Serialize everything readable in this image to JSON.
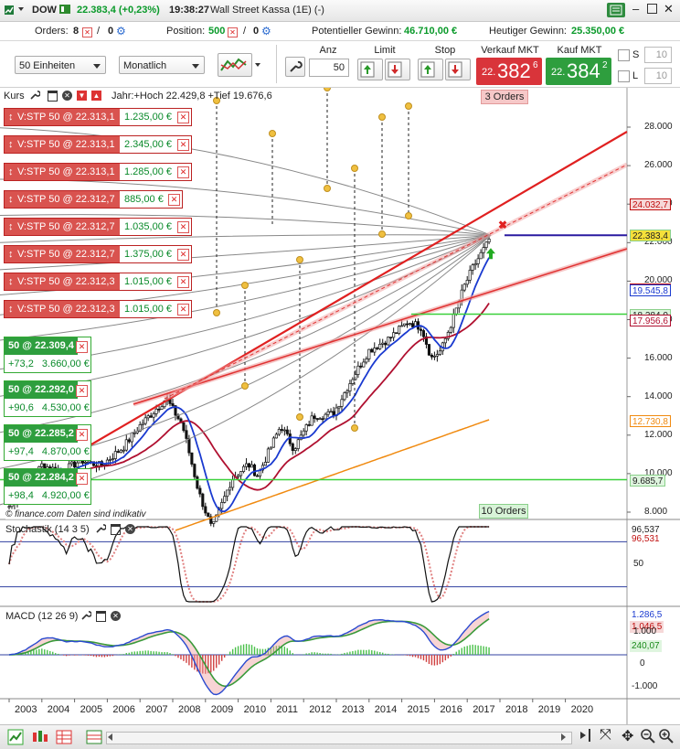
{
  "header": {
    "symbol": "DOW",
    "price_line": "22.383,4 (+0,23%)",
    "time": "19:38:27",
    "exchange": "Wall Street Kassa (1E) (-)"
  },
  "account": {
    "orders_label": "Orders:",
    "orders_count": "8",
    "orders_separator": "/",
    "orders_alerts": "0",
    "position_label": "Position:",
    "position_value": "500",
    "position_separator": "/",
    "position_alerts": "0",
    "potential_label": "Potentieller Gewinn:",
    "potential_value": "46.710,00 €",
    "today_label": "Heutiger Gewinn:",
    "today_value": "25.350,00 €"
  },
  "toolbar": {
    "units_select": "50 Einheiten",
    "period_select": "Monatlich",
    "qty_header": "Anz",
    "qty_value": "50",
    "limit_header": "Limit",
    "stop_header": "Stop",
    "sell_header": "Verkauf MKT",
    "sell_prefix": "22.",
    "sell_main": "382",
    "sell_sup": "6",
    "buy_header": "Kauf MKT",
    "buy_prefix": "22.",
    "buy_main": "384",
    "buy_sup": "2",
    "s_label": "S",
    "s_value": "10",
    "l_label": "L",
    "l_value": "10"
  },
  "price_panel": {
    "title": "Kurs",
    "info": "Jahr:+Hoch 22.429,8 +Tief 19.676,6",
    "orders_top_badge": "3 Orders",
    "orders_bottom_badge": "10 Orders",
    "watermark": "© finance.com  Daten sind indikativ",
    "y_ticks": [
      "28.000",
      "26.000",
      "24.000",
      "22.000",
      "20.000",
      "18.000",
      "16.000",
      "14.000",
      "12.000",
      "10.000",
      "8.000"
    ],
    "price_tags": [
      {
        "text": "24.032,7",
        "bg": "#f6d8d8",
        "fg": "#c01010",
        "value": 24032.7
      },
      {
        "text": "22.384,7",
        "bg": "#ffffff",
        "fg": "#c01010",
        "value": 22384.7
      },
      {
        "text": "22.383,4",
        "bg": "#f5e03a",
        "fg": "#222222",
        "value": 22383.4
      },
      {
        "text": "19.585,4",
        "bg": "#ffffff",
        "fg": "#c01010",
        "value": 19585.4
      },
      {
        "text": "19.545,8",
        "bg": "#ffffff",
        "fg": "#1a3ad0",
        "value": 19545.8
      },
      {
        "text": "18.284,0",
        "bg": "#dff5df",
        "fg": "#222222",
        "value": 18284.0
      },
      {
        "text": "17.956,6",
        "bg": "#ffffff",
        "fg": "#b01030",
        "value": 17956.6
      },
      {
        "text": "12.730,8",
        "bg": "#ffffff",
        "fg": "#f08a10",
        "value": 12730.8
      },
      {
        "text": "9.685,7",
        "bg": "#dff5df",
        "fg": "#222222",
        "value": 9685.7
      }
    ],
    "stop_orders": [
      {
        "label": "V:STP  50 @ 22.313,1",
        "amount": "1.235,00 €"
      },
      {
        "label": "V:STP  50 @ 22.313,1",
        "amount": "2.345,00 €"
      },
      {
        "label": "V:STP  50 @ 22.313,1",
        "amount": "1.285,00 €"
      },
      {
        "label": "V:STP  50 @ 22.312,7",
        "amount": "885,00 €"
      },
      {
        "label": "V:STP  50 @ 22.312,7",
        "amount": "1.035,00 €"
      },
      {
        "label": "V:STP  50 @ 22.312,7",
        "amount": "1.375,00 €"
      },
      {
        "label": "V:STP  50 @ 22.312,3",
        "amount": "1.015,00 €"
      },
      {
        "label": "V:STP  50 @ 22.312,3",
        "amount": "1.015,00 €"
      }
    ],
    "positions": [
      {
        "entry": "50 @ 22.309,4",
        "pts": "+73,2",
        "profit": "3.660,00 €"
      },
      {
        "entry": "50 @ 22.292,0",
        "pts": "+90,6",
        "profit": "4.530,00 €"
      },
      {
        "entry": "50 @ 22.285,2",
        "pts": "+97,4",
        "profit": "4.870,00 €"
      },
      {
        "entry": "50 @ 22.284,2",
        "pts": "+98,4",
        "profit": "4.920,00 €"
      }
    ]
  },
  "stochastic_panel": {
    "title": "Stochastik (14 3 5)",
    "value1": "96,537",
    "value2": "96,531",
    "y_ticks": [
      "50"
    ]
  },
  "macd_panel": {
    "title": "MACD (12 26 9)",
    "value1": "1.286,5",
    "value2": "1.046,5",
    "value3": "240,07",
    "y_ticks": [
      "1.000",
      "0",
      "-1.000"
    ]
  },
  "x_axis": [
    "2003",
    "2004",
    "2005",
    "2006",
    "2007",
    "2008",
    "2009",
    "2010",
    "2011",
    "2012",
    "2013",
    "2014",
    "2015",
    "2016",
    "2017",
    "2018",
    "2019",
    "2020"
  ],
  "chart_data": {
    "type": "line",
    "x": [
      2003,
      2004,
      2005,
      2006,
      2007,
      2008,
      2009,
      2010,
      2011,
      2012,
      2013,
      2014,
      2015,
      2016,
      2017,
      2017.7
    ],
    "series": [
      {
        "name": "DOW",
        "values": [
          8300,
          10450,
          10700,
          11400,
          13500,
          12500,
          8000,
          10500,
          12200,
          13000,
          15000,
          17200,
          17500,
          16500,
          19800,
          22383
        ]
      }
    ],
    "ylim": [
      7500,
      29000
    ]
  },
  "colors": {
    "price_line": "#2a1aa0",
    "fan_line": "#e02020",
    "ma_blue": "#1a3ad0",
    "ma_red": "#b01030",
    "ma_orange": "#f08a10",
    "green_level": "#3ad03a"
  }
}
